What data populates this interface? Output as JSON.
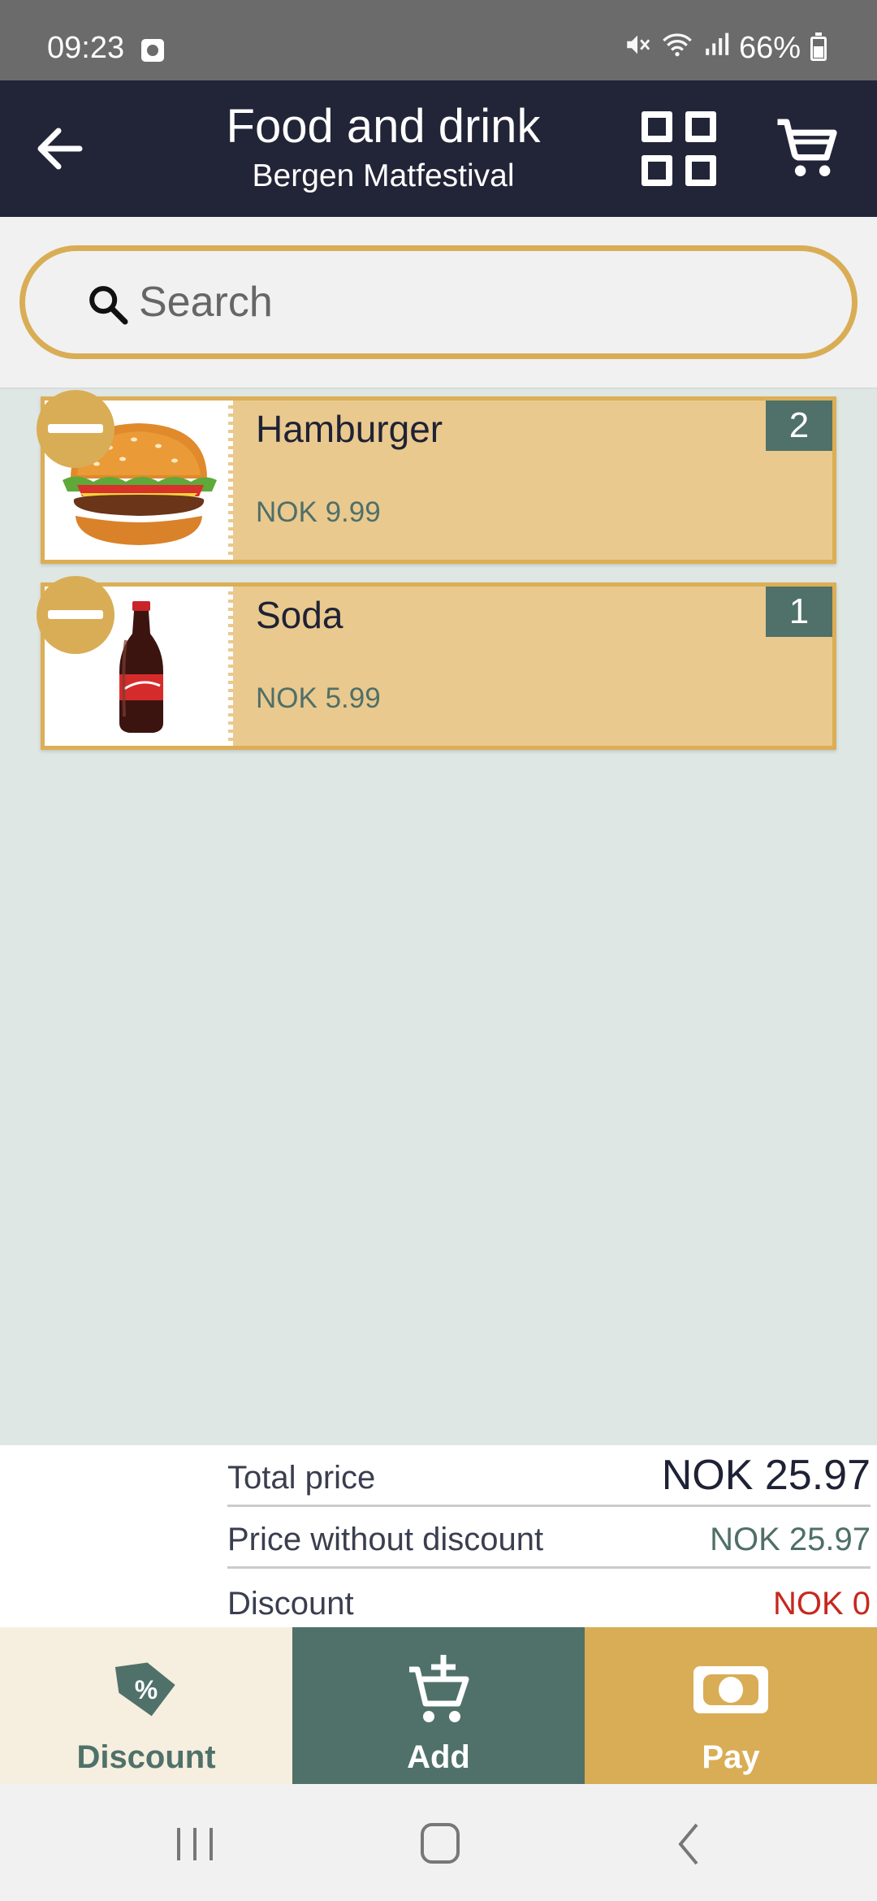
{
  "status_bar": {
    "time": "09:23",
    "battery": "66%",
    "icons": [
      "notification-icon",
      "mute-icon",
      "wifi-icon",
      "signal-icon",
      "battery-icon"
    ]
  },
  "header": {
    "title": "Food and drink",
    "subtitle": "Bergen Matfestival",
    "icons": [
      "back-arrow-icon",
      "grid-view-icon",
      "cart-icon"
    ]
  },
  "search": {
    "placeholder": "Search",
    "value": ""
  },
  "items": [
    {
      "name": "Hamburger",
      "price": "NOK 9.99",
      "quantity": "2",
      "image": "hamburger-icon"
    },
    {
      "name": "Soda",
      "price": "NOK 5.99",
      "quantity": "1",
      "image": "soda-bottle-icon"
    }
  ],
  "totals": {
    "total_label": "Total price",
    "total_value": "NOK 25.97",
    "without_discount_label": "Price without discount",
    "without_discount_value": "NOK 25.97",
    "discount_label": "Discount",
    "discount_value": "NOK 0"
  },
  "actions": {
    "discount": "Discount",
    "add": "Add",
    "pay": "Pay"
  },
  "colors": {
    "header": "#222438",
    "accent_gold": "#d9ad55",
    "item_bg": "#e9c98e",
    "green": "#4f7169",
    "discount_red": "#c6281e",
    "list_bg": "#dfe7e4"
  }
}
